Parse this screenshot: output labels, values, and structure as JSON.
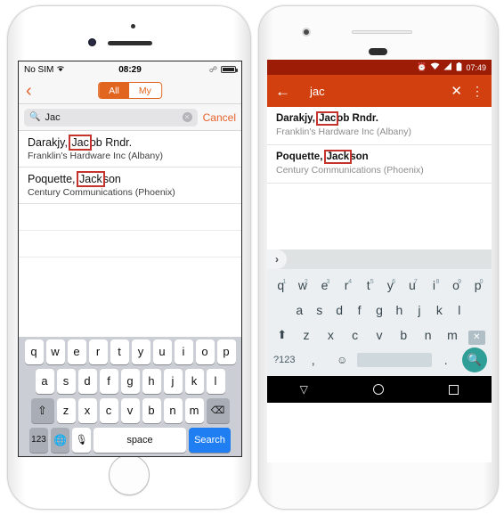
{
  "iphone": {
    "status": {
      "carrier": "No SIM",
      "wifi_icon": "wifi-icon",
      "time": "08:29",
      "bluetooth_icon": "bluetooth-icon",
      "battery_icon": "battery-icon"
    },
    "navbar": {
      "back_icon": "chevron-left-icon",
      "segment": {
        "options": [
          "All",
          "My"
        ],
        "selected": "All"
      }
    },
    "search": {
      "icon": "search-icon",
      "value": "Jac",
      "placeholder": "Search",
      "clear_icon": "clear-icon",
      "cancel_label": "Cancel"
    },
    "results": [
      {
        "name_prefix": "Darakjy, ",
        "name_match": "Jac",
        "name_suffix": "ob Rndr.",
        "company": "Franklin's Hardware Inc (Albany)"
      },
      {
        "name_prefix": "Poquette, ",
        "name_match": "Jack",
        "name_suffix": "son",
        "company": "Century Communications (Phoenix)"
      }
    ],
    "keyboard": {
      "row1": [
        "q",
        "w",
        "e",
        "r",
        "t",
        "y",
        "u",
        "i",
        "o",
        "p"
      ],
      "row2": [
        "a",
        "s",
        "d",
        "f",
        "g",
        "h",
        "j",
        "k",
        "l"
      ],
      "row3": [
        "z",
        "x",
        "c",
        "v",
        "b",
        "n",
        "m"
      ],
      "shift_icon": "shift-icon",
      "delete_icon": "backspace-icon",
      "numbers_label": "123",
      "globe_icon": "globe-icon",
      "mic_icon": "microphone-icon",
      "space_label": "space",
      "return_label": "Search"
    }
  },
  "android": {
    "status": {
      "alarm_icon": "alarm-icon",
      "wifi_icon": "wifi-icon",
      "signal_icon": "signal-icon",
      "battery_icon": "battery-icon",
      "time": "07:49"
    },
    "toolbar": {
      "back_icon": "arrow-left-icon",
      "query": "jac",
      "clear_icon": "close-icon",
      "overflow_icon": "more-vertical-icon"
    },
    "results": [
      {
        "name_prefix": "Darakjy, ",
        "name_match": "Jac",
        "name_suffix": "ob Rndr.",
        "company": "Franklin's Hardware Inc (Albany)"
      },
      {
        "name_prefix": "Poquette, ",
        "name_match": "Jack",
        "name_suffix": "son",
        "company": "Century Communications (Phoenix)"
      }
    ],
    "suggestion_bar": {
      "expand_icon": "chevron-right-icon"
    },
    "keyboard": {
      "row1": [
        {
          "letter": "q",
          "num": "1"
        },
        {
          "letter": "w",
          "num": "2"
        },
        {
          "letter": "e",
          "num": "3"
        },
        {
          "letter": "r",
          "num": "4"
        },
        {
          "letter": "t",
          "num": "5"
        },
        {
          "letter": "y",
          "num": "6"
        },
        {
          "letter": "u",
          "num": "7"
        },
        {
          "letter": "i",
          "num": "8"
        },
        {
          "letter": "o",
          "num": "9"
        },
        {
          "letter": "p",
          "num": "0"
        }
      ],
      "row2": [
        "a",
        "s",
        "d",
        "f",
        "g",
        "h",
        "j",
        "k",
        "l"
      ],
      "row3": [
        "z",
        "x",
        "c",
        "v",
        "b",
        "n",
        "m"
      ],
      "shift_icon": "shift-icon",
      "delete_icon": "backspace-icon",
      "symbols_label": "?123",
      "comma_label": ",",
      "emoji_icon": "emoji-icon",
      "period_label": ".",
      "search_icon": "search-icon"
    },
    "navbar": {
      "back_icon": "nav-back-icon",
      "home_icon": "nav-home-icon",
      "recents_icon": "nav-recents-icon"
    }
  },
  "colors": {
    "ios_accent": "#e8622c",
    "ios_return_blue": "#1f7ef2",
    "android_status": "#9c1c06",
    "android_toolbar": "#d2400f",
    "android_go_teal": "#2e9e97",
    "highlight_box": "#c4332c"
  }
}
